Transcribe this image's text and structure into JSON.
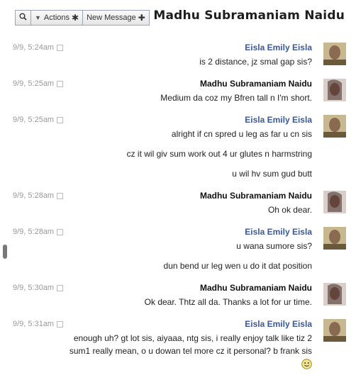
{
  "header": {
    "title": "Madhu Subramaniam Naidu",
    "new_message_label": "New Message",
    "actions_label": "Actions"
  },
  "messages": [
    {
      "sender": "Eisla Emily Eisla",
      "time": "9/9, 5:24am",
      "lines": [
        "is 2 distance, jz smal gap sis?"
      ]
    },
    {
      "sender": "Madhu Subramaniam Naidu",
      "time": "9/9, 5:25am",
      "lines": [
        "Medium da coz my Bfren tall n I'm short."
      ]
    },
    {
      "sender": "Eisla Emily Eisla",
      "time": "9/9, 5:25am",
      "lines": [
        "alright if cn spred u leg as far u cn sis",
        "cz it wil giv sum work out 4 ur glutes n harmstring",
        "u wil hv sum gud butt"
      ]
    },
    {
      "sender": "Madhu Subramaniam Naidu",
      "time": "9/9, 5:28am",
      "lines": [
        "Oh ok dear."
      ]
    },
    {
      "sender": "Eisla Emily Eisla",
      "time": "9/9, 5:28am",
      "lines": [
        "u wana sumore sis?",
        "dun bend ur leg wen u do it dat position"
      ]
    },
    {
      "sender": "Madhu Subramaniam Naidu",
      "time": "9/9, 5:30am",
      "lines": [
        "Ok dear. Thtz all da. Thanks a lot for ur time."
      ]
    },
    {
      "sender": "Eisla Emily Eisla",
      "time": "9/9, 5:31am",
      "lines": [
        "enough uh? gt lot sis, aiyaaa, ntg sis, i really enjoy talk like tiz 2",
        "sum1 really mean, o u dowan tel more cz it personal? b frank sis"
      ]
    }
  ],
  "colors": {
    "link": "#3b5998",
    "timestamp": "#999999"
  },
  "icons": {
    "search": "search-icon",
    "dropdown": "chevron-down-icon",
    "gear": "gear-icon",
    "plus": "plus-icon",
    "smiley": "smiley-icon"
  }
}
